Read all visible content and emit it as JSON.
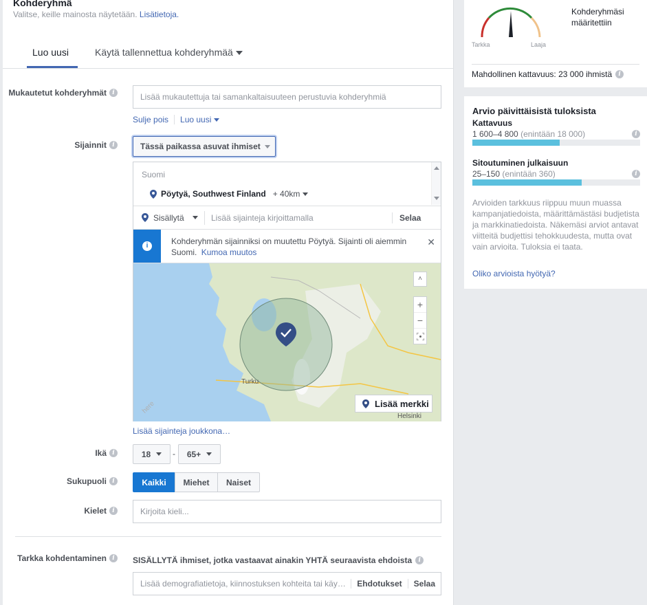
{
  "section": {
    "title": "Kohderyhmä",
    "subtitle": "Valitse, keille mainosta näytetään.",
    "more_link": "Lisätietoja."
  },
  "tabs": [
    {
      "label": "Luo uusi",
      "active": true
    },
    {
      "label": "Käytä tallennettua kohderyhmää",
      "active": false
    }
  ],
  "custom_audiences": {
    "label": "Mukautetut kohderyhmät",
    "placeholder": "Lisää mukautettuja tai samankaltaisuuteen perustuvia kohderyhmiä",
    "exclude_link": "Sulje pois",
    "create_link": "Luo uusi"
  },
  "locations": {
    "label": "Sijainnit",
    "type_select": "Tässä paikassa asuvat ihmiset",
    "country": "Suomi",
    "selected_place": "Pöytyä, Southwest Finland",
    "radius": "+ 40km",
    "include_select": "Sisällytä",
    "search_placeholder": "Lisää sijainteja kirjoittamalla",
    "browse": "Selaa",
    "notice_text": "Kohderyhmän sijainniksi on muutettu Pöytyä. Sijainti oli aiemmin Suomi.",
    "undo_link": "Kumoa muutos",
    "map_labels": {
      "turku": "Turku",
      "helsinki": "Helsinki"
    },
    "add_pin": "Lisää merkki",
    "bulk_link": "Lisää sijainteja joukkona…"
  },
  "age": {
    "label": "Ikä",
    "min": "18",
    "separator": "-",
    "max": "65+"
  },
  "gender": {
    "label": "Sukupuoli",
    "options": [
      "Kaikki",
      "Miehet",
      "Naiset"
    ],
    "selected": "Kaikki"
  },
  "languages": {
    "label": "Kielet",
    "placeholder": "Kirjoita kieli..."
  },
  "detailed": {
    "label": "Tarkka kohdentaminen",
    "heading": "SISÄLLYTÄ ihmiset, jotka vastaavat ainakin YHTÄ seuraavista ehdoista",
    "placeholder": "Lisää demografiatietoja, kiinnostuksen kohteita tai käy…",
    "suggestions": "Ehdotukset",
    "browse": "Selaa"
  },
  "audience_meter": {
    "status": "Kohderyhmäsi määritettiin",
    "narrow": "Tarkka",
    "broad": "Laaja",
    "reach": "Mahdollinen kattavuus: 23 000 ihmistä"
  },
  "estimates": {
    "title": "Arvio päivittäisistä tuloksista",
    "reach_label": "Kattavuus",
    "reach_value": "1 600–4 800",
    "reach_max": "(enintään 18 000)",
    "reach_fill": 0.52,
    "engagement_label": "Sitoutuminen julkaisuun",
    "engagement_value": "25–150",
    "engagement_max": "(enintään 360)",
    "engagement_fill": 0.65,
    "disclaimer": "Arvioiden tarkkuus riippuu muun muassa kampanjatiedoista, määrittämästäsi budjetista ja markkinatiedoista. Näkemäsi arviot antavat viitteitä budjettisi tehokkuudesta, mutta ovat vain arvioita. Tuloksia ei taata.",
    "feedback_link": "Oliko arvioista hyötyä?"
  },
  "colors": {
    "accent": "#4267b2",
    "selected_button": "#1877d2",
    "bar": "#5bc0de"
  }
}
